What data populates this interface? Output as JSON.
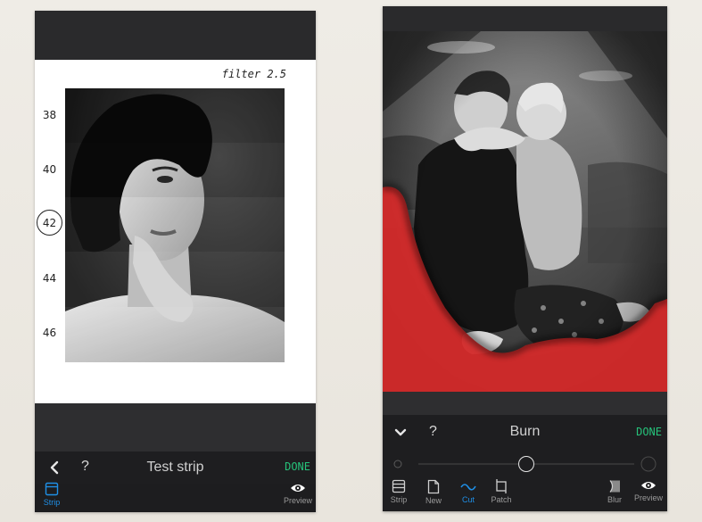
{
  "left_screen": {
    "filter_label": "filter 2.5",
    "strip_numbers": [
      "38",
      "40",
      "42",
      "44",
      "46"
    ],
    "selected_strip": "42",
    "header": {
      "title": "Test strip",
      "help": "?",
      "done_label": "DONE"
    },
    "toolbar": [
      {
        "label": "Strip",
        "icon": "strip-icon",
        "active": true
      },
      {
        "label": "Preview",
        "icon": "eye-icon",
        "active": false
      }
    ]
  },
  "right_screen": {
    "header": {
      "title": "Burn",
      "help": "?",
      "done_label": "DONE"
    },
    "slider": {
      "value": 0.5
    },
    "toolbar": [
      {
        "label": "Strip",
        "icon": "strip-icon",
        "active": false
      },
      {
        "label": "New",
        "icon": "new-document-icon",
        "active": false
      },
      {
        "label": "Cut",
        "icon": "cut-curve-icon",
        "active": true
      },
      {
        "label": "Patch",
        "icon": "patch-icon",
        "active": false
      },
      {
        "label": "Blur",
        "icon": "blur-icon",
        "active": false
      },
      {
        "label": "Preview",
        "icon": "eye-icon",
        "active": false
      }
    ]
  },
  "colors": {
    "accent_blue": "#1f8fe6",
    "done_green": "#26c27a",
    "burn_mask_red": "#d42a2a"
  }
}
